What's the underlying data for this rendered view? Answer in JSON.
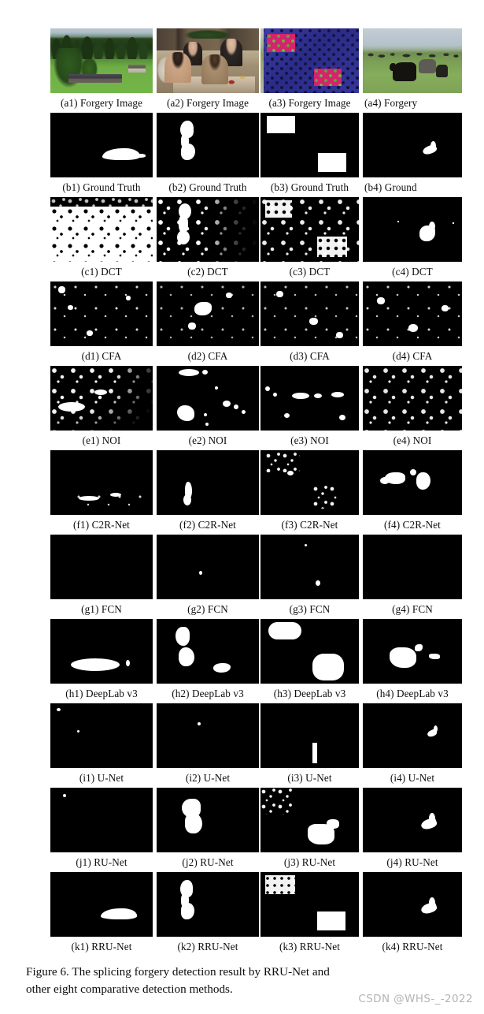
{
  "figure": {
    "caption_line1": "Figure 6. The splicing forgery detection result by RRU-Net and",
    "caption_line2": "other eight comparative detection methods.",
    "watermark": "CSDN @WHS-_-2022",
    "columns": 4,
    "rows": [
      {
        "id": "a",
        "kind": "photo",
        "method": "Forgery Image",
        "labels": [
          "(a1) Forgery Image",
          "(a2) Forgery Image",
          "(a3) Forgery Image",
          "(a4) Forgery"
        ],
        "cells": [
          {
            "name": "alpine-meadow-with-barn"
          },
          {
            "name": "indoor-family-dinner"
          },
          {
            "name": "blue-dotted-fabric-with-magenta-patches"
          },
          {
            "name": "cattle-in-field"
          }
        ]
      },
      {
        "id": "b",
        "kind": "mask",
        "method": "Ground Truth",
        "labels": [
          "(b1) Ground Truth",
          "(b2) Ground Truth",
          "(b3) Ground Truth",
          "(b4) Ground"
        ]
      },
      {
        "id": "c",
        "kind": "mask",
        "method": "DCT",
        "labels": [
          "(c1) DCT",
          "(c2) DCT",
          "(c3) DCT",
          "(c4) DCT"
        ]
      },
      {
        "id": "d",
        "kind": "mask",
        "method": "CFA",
        "labels": [
          "(d1) CFA",
          "(d2) CFA",
          "(d3) CFA",
          "(d4) CFA"
        ]
      },
      {
        "id": "e",
        "kind": "mask",
        "method": "NOI",
        "labels": [
          "(e1) NOI",
          "(e2) NOI",
          "(e3) NOI",
          "(e4) NOI"
        ]
      },
      {
        "id": "f",
        "kind": "mask",
        "method": "C2R-Net",
        "labels": [
          "(f1) C2R-Net",
          "(f2) C2R-Net",
          "(f3) C2R-Net",
          "(f4) C2R-Net"
        ]
      },
      {
        "id": "g",
        "kind": "mask",
        "method": "FCN",
        "labels": [
          "(g1) FCN",
          "(g2) FCN",
          "(g3) FCN",
          "(g4) FCN"
        ]
      },
      {
        "id": "h",
        "kind": "mask",
        "method": "DeepLab v3",
        "labels": [
          "(h1) DeepLab v3",
          "(h2) DeepLab v3",
          "(h3) DeepLab v3",
          "(h4) DeepLab v3"
        ]
      },
      {
        "id": "i",
        "kind": "mask",
        "method": "U-Net",
        "labels": [
          "(i1) U-Net",
          "(i2) U-Net",
          "(i3) U-Net",
          "(i4) U-Net"
        ]
      },
      {
        "id": "j",
        "kind": "mask",
        "method": "RU-Net",
        "labels": [
          "(j1) RU-Net",
          "(j2) RU-Net",
          "(j3) RU-Net",
          "(j4) RU-Net"
        ]
      },
      {
        "id": "k",
        "kind": "mask",
        "method": "RRU-Net",
        "labels": [
          "(k1) RRU-Net",
          "(k2) RRU-Net",
          "(k3) RRU-Net",
          "(k4) RRU-Net"
        ]
      }
    ],
    "colors": {
      "mask_background": "#000000",
      "mask_foreground": "#ffffff",
      "page_background": "#ffffff",
      "text": "#0c0c0c",
      "watermark": "#b4b4b4"
    }
  }
}
